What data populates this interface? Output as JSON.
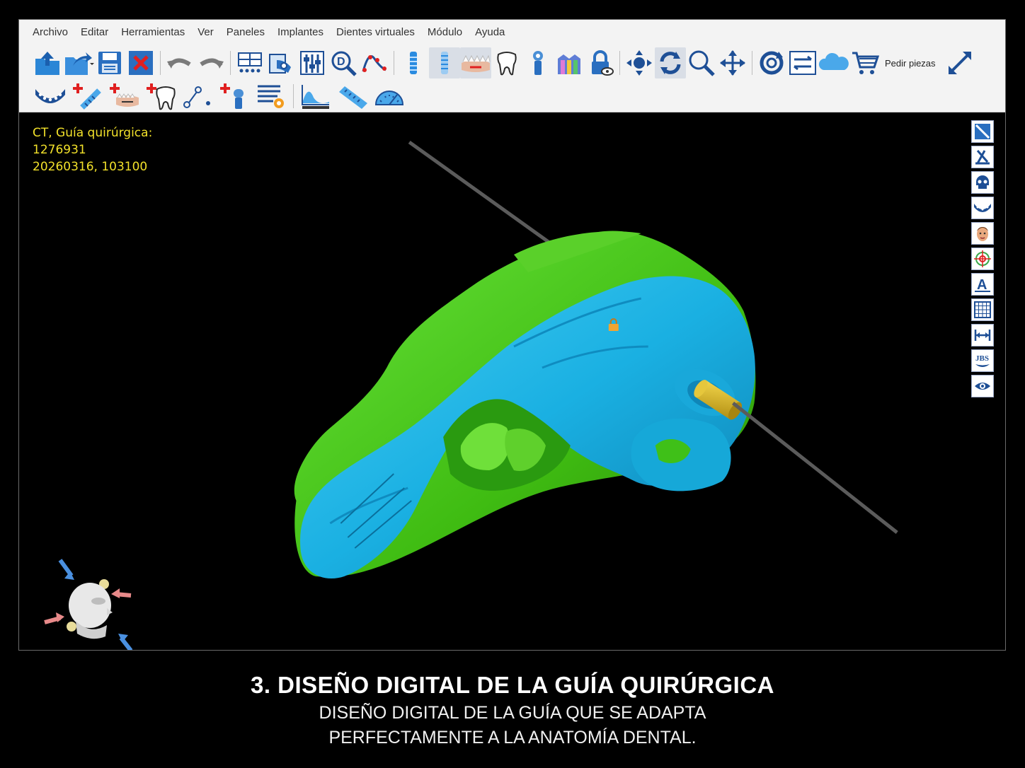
{
  "menu": {
    "items": [
      "Archivo",
      "Editar",
      "Herramientas",
      "Ver",
      "Paneles",
      "Implantes",
      "Dientes virtuales",
      "Módulo",
      "Ayuda"
    ]
  },
  "toolbar": {
    "order_parts_label": "Pedir piezas",
    "icons_row1": [
      "open-icon",
      "import-icon",
      "save-icon",
      "close-icon",
      "undo-icon",
      "redo-icon",
      "layout-icon",
      "scan-icon",
      "sliders-icon",
      "zoom-d-icon",
      "curve-icon",
      "implant-icon",
      "implant-outline-icon",
      "jaw-icon",
      "tooth-icon",
      "abutment-icon",
      "model-icon",
      "lock-view-icon",
      "center-icon",
      "rotate-icon",
      "zoom-icon",
      "pan-icon",
      "spin-icon",
      "swap-icon",
      "cloud-icon",
      "cart-icon",
      "fullscreen-icon"
    ],
    "icons_row2": [
      "arch-icon",
      "add-implant-icon",
      "add-jaw-icon",
      "add-tooth-icon",
      "add-point-icon",
      "add-sleeve-icon",
      "settings-list-icon",
      "histogram-icon",
      "ruler-icon",
      "protractor-icon"
    ]
  },
  "viewport": {
    "info_lines": [
      "CT, Guía quirúrgica:",
      "1276931",
      "20260316, 103100"
    ],
    "colors": {
      "tissue": "#4fd21a",
      "guide": "#1db4e6",
      "sleeve": "#d8b92a",
      "axis": "#5a5a5a",
      "overlay_text": "#f2e12a"
    },
    "side_tools": [
      "slice-icon",
      "axis-icon",
      "skull-icon",
      "arch-view-icon",
      "face-icon",
      "target-icon",
      "text-icon",
      "grid-icon",
      "measure-icon",
      "logo-icon",
      "eye-icon"
    ]
  },
  "caption": {
    "title": "3. DISEÑO DIGITAL DE LA GUÍA QUIRÚRGICA",
    "line1": "DISEÑO DIGITAL DE LA GUÍA QUE SE ADAPTA",
    "line2": "PERFECTAMENTE A LA ANATOMÍA DENTAL."
  }
}
